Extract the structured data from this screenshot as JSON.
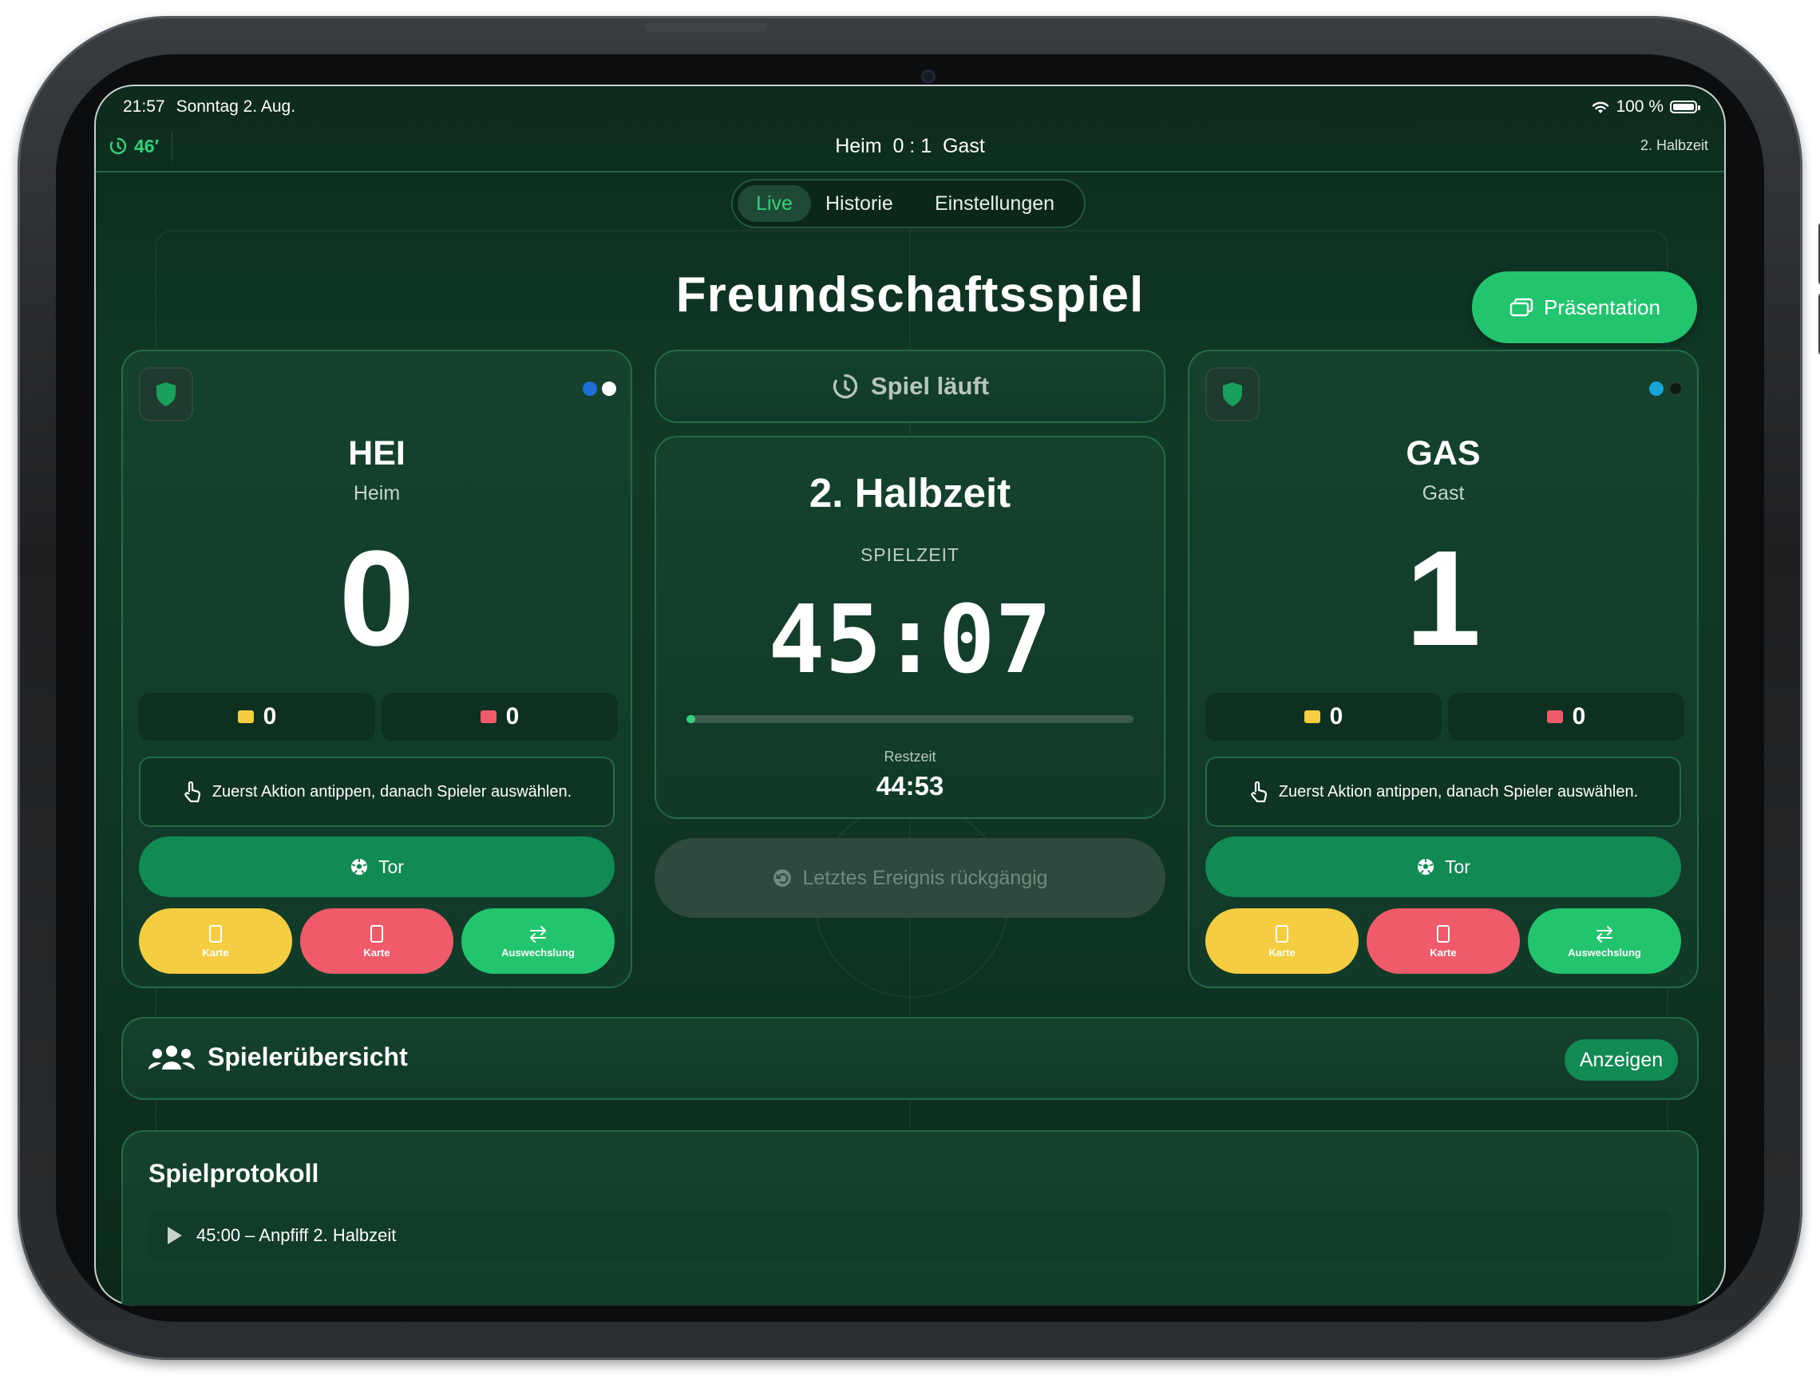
{
  "status_bar": {
    "time": "21:57",
    "date": "Sonntag 2. Aug.",
    "battery": "100 %"
  },
  "top_bar": {
    "minute": "46′",
    "match_title": "Heim  0 : 1  Gast",
    "half": "2. Halbzeit"
  },
  "tabs": [
    {
      "label": "Live",
      "selected": true
    },
    {
      "label": "Historie"
    },
    {
      "label": "Einstellungen"
    }
  ],
  "page": {
    "title": "Freundschaftsspiel",
    "presentation_label": "Präsentation"
  },
  "home": {
    "abbr": "HEI",
    "name": "Heim",
    "score": "0",
    "kit_colors": [
      "#1f6fd6",
      "#ffffff"
    ],
    "yellow_cards": "0",
    "red_cards": "0",
    "hint": "Zuerst Aktion antippen, danach Spieler auswählen.",
    "goal_label": "Tor",
    "yellow_label": "Karte",
    "red_label": "Karte",
    "sub_label": "Auswechslung"
  },
  "away": {
    "abbr": "GAS",
    "name": "Gast",
    "score": "1",
    "kit_colors": [
      "#1aa3d6",
      "#0b1c14"
    ],
    "yellow_cards": "0",
    "red_cards": "0",
    "hint": "Zuerst Aktion antippen, danach Spieler auswählen.",
    "goal_label": "Tor",
    "yellow_label": "Karte",
    "red_label": "Karte",
    "sub_label": "Auswechslung"
  },
  "clock": {
    "status": "Spiel läuft",
    "half": "2. Halbzeit",
    "label": "SPIELZEIT",
    "time": "45:07",
    "progress_fraction": 0.02,
    "remaining_label": "Restzeit",
    "remaining": "44:53",
    "undo_label": "Letztes Ereignis rückgängig"
  },
  "overview": {
    "title": "Spielerübersicht",
    "button": "Anzeigen"
  },
  "protocol": {
    "title": "Spielprotokoll",
    "entries": [
      "45:00 – Anpfiff 2. Halbzeit"
    ]
  },
  "colors": {
    "accent": "#22c46e",
    "goal_button": "#128a54",
    "yellow": "#f5cd40",
    "red": "#ef5b6a"
  }
}
